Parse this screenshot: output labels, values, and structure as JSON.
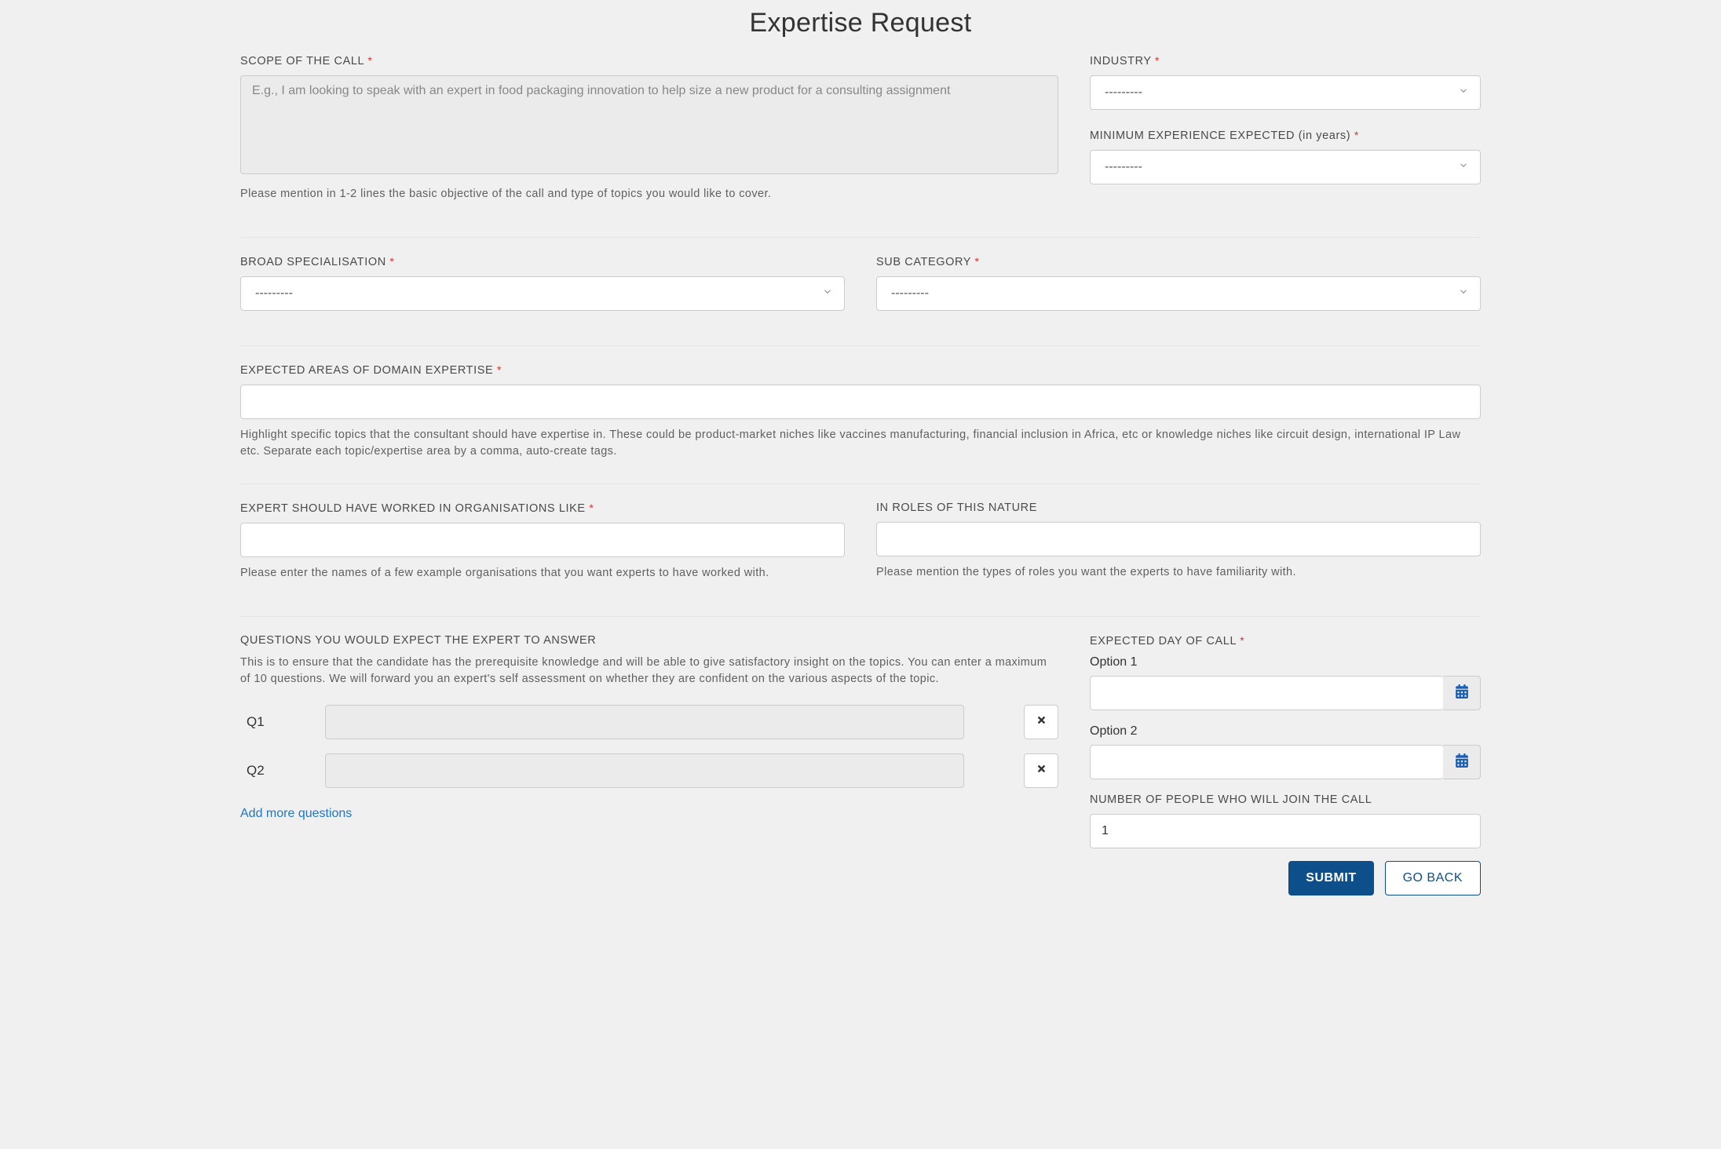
{
  "page": {
    "title": "Expertise Request"
  },
  "scope": {
    "label": "SCOPE OF THE CALL",
    "placeholder": "E.g., I am looking to speak with an expert in food packaging innovation to help size a new product for a consulting assignment",
    "value": "",
    "help": "Please mention in 1-2 lines the basic objective of the call and type of topics you would like to cover."
  },
  "industry": {
    "label": "INDUSTRY",
    "selected": "---------"
  },
  "min_experience": {
    "label": "MINIMUM EXPERIENCE EXPECTED (in years)",
    "selected": "---------"
  },
  "broad_spec": {
    "label": "BROAD SPECIALISATION",
    "selected": "---------"
  },
  "sub_category": {
    "label": "SUB CATEGORY",
    "selected": "---------"
  },
  "domain_expertise": {
    "label": "EXPECTED AREAS OF DOMAIN EXPERTISE",
    "value": "",
    "help": "Highlight specific topics that the consultant should have expertise in. These could be product-market niches like vaccines manufacturing, financial inclusion in Africa, etc or knowledge niches like circuit design, international IP Law etc. Separate each topic/expertise area by a comma, auto-create tags."
  },
  "orgs": {
    "label": "EXPERT SHOULD HAVE WORKED IN ORGANISATIONS LIKE",
    "value": "",
    "help": "Please enter the names of a few example organisations that you want experts to have worked with."
  },
  "roles": {
    "label": "IN ROLES OF THIS NATURE",
    "value": "",
    "help": "Please mention the types of roles you want the experts to have familiarity with."
  },
  "questions": {
    "label": "QUESTIONS YOU WOULD EXPECT THE EXPERT TO ANSWER",
    "help": "This is to ensure that the candidate has the prerequisite knowledge and will be able to give satisfactory insight on the topics. You can enter a maximum of 10 questions. We will forward you an expert's self assessment on whether they are confident on the various aspects of the topic.",
    "items": [
      {
        "label": "Q1",
        "value": ""
      },
      {
        "label": "Q2",
        "value": ""
      }
    ],
    "add_more": "Add more questions"
  },
  "call_day": {
    "label": "EXPECTED DAY OF CALL",
    "options": [
      {
        "label": "Option 1",
        "value": ""
      },
      {
        "label": "Option 2",
        "value": ""
      }
    ]
  },
  "num_people": {
    "label": "NUMBER OF PEOPLE WHO WILL JOIN THE CALL",
    "value": "1"
  },
  "buttons": {
    "submit": "SUBMIT",
    "go_back": "GO BACK"
  }
}
